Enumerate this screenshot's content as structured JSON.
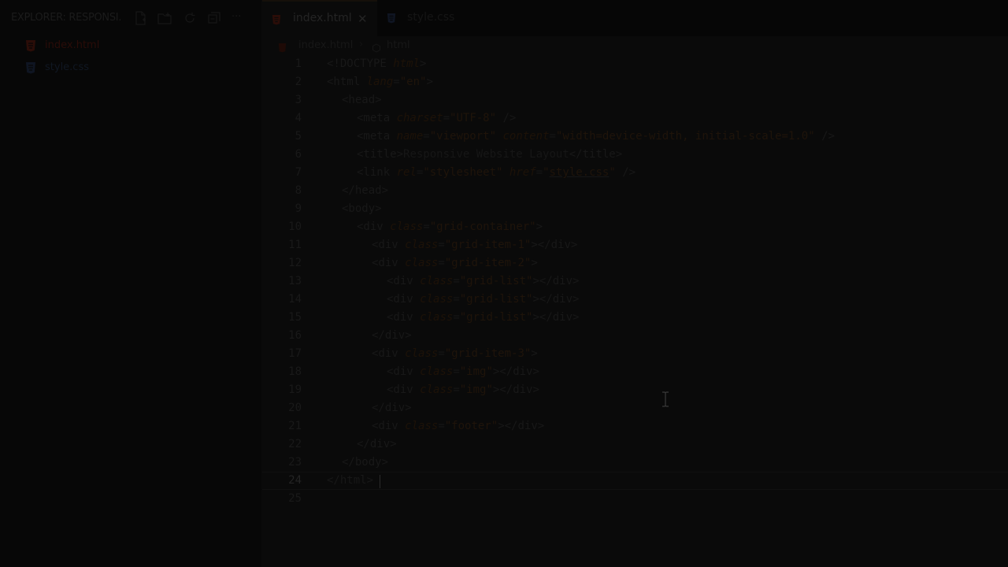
{
  "sidebar": {
    "title": "EXPLORER: RESPONSI...",
    "icons": [
      "new-file-icon",
      "new-folder-icon",
      "refresh-icon",
      "collapse-all-icon",
      "more-icon"
    ],
    "more_label": "···",
    "files": [
      {
        "name": "index.html",
        "icon": "html-file-icon"
      },
      {
        "name": "style.css",
        "icon": "css-file-icon"
      }
    ]
  },
  "tabs": [
    {
      "label": "index.html",
      "active": true,
      "close": "✕"
    },
    {
      "label": "style.css",
      "active": false
    }
  ],
  "breadcrumb": {
    "file": "index.html",
    "separator": "›",
    "element": "html"
  },
  "code_lines": [
    {
      "n": "1"
    },
    {
      "n": "2"
    },
    {
      "n": "3"
    },
    {
      "n": "4"
    },
    {
      "n": "5"
    },
    {
      "n": "6"
    },
    {
      "n": "7"
    },
    {
      "n": "8"
    },
    {
      "n": "9"
    },
    {
      "n": "10"
    },
    {
      "n": "11"
    },
    {
      "n": "12"
    },
    {
      "n": "13"
    },
    {
      "n": "14"
    },
    {
      "n": "15"
    },
    {
      "n": "16"
    },
    {
      "n": "17"
    },
    {
      "n": "18"
    },
    {
      "n": "19"
    },
    {
      "n": "20"
    },
    {
      "n": "21"
    },
    {
      "n": "22"
    },
    {
      "n": "23"
    },
    {
      "n": "24"
    },
    {
      "n": "25"
    }
  ],
  "code": {
    "l1": {
      "a": "<!DOCTYPE ",
      "b": "html",
      "c": ">"
    },
    "l2": {
      "a": "<html ",
      "b": "lang",
      "c": "=",
      "d": "\"en\"",
      "e": ">"
    },
    "l3": {
      "a": "<head>"
    },
    "l4": {
      "a": "<meta ",
      "b": "charset",
      "c": "=",
      "d": "\"UTF-8\"",
      "e": " />"
    },
    "l5": {
      "a": "<meta ",
      "b": "name",
      "c": "=",
      "d": "\"viewport\"",
      "e": " ",
      "f": "content",
      "g": "=",
      "h": "\"width=device-width, initial-scale=1.0\"",
      "i": " />"
    },
    "l6": {
      "a": "<title>",
      "b": "Responsive Website Layout",
      "c": "</title>"
    },
    "l7": {
      "a": "<link ",
      "b": "rel",
      "c": "=",
      "d": "\"stylesheet\"",
      "e": " ",
      "f": "href",
      "g": "=",
      "h": "\"",
      "i": "style.css",
      "j": "\"",
      "k": " />"
    },
    "l8": {
      "a": "</head>"
    },
    "l9": {
      "a": "<body>"
    },
    "l10": {
      "a": "<div ",
      "b": "class",
      "c": "=",
      "d": "\"grid-container\"",
      "e": ">"
    },
    "l11": {
      "a": "<div ",
      "b": "class",
      "c": "=",
      "d": "\"grid-item-1\"",
      "e": "></div>"
    },
    "l12": {
      "a": "<div ",
      "b": "class",
      "c": "=",
      "d": "\"grid-item-2\"",
      "e": ">"
    },
    "l13": {
      "a": "<div ",
      "b": "class",
      "c": "=",
      "d": "\"grid-list\"",
      "e": "></div>"
    },
    "l14": {
      "a": "<div ",
      "b": "class",
      "c": "=",
      "d": "\"grid-list\"",
      "e": "></div>"
    },
    "l15": {
      "a": "<div ",
      "b": "class",
      "c": "=",
      "d": "\"grid-list\"",
      "e": "></div>"
    },
    "l16": {
      "a": "</div>"
    },
    "l17": {
      "a": "<div ",
      "b": "class",
      "c": "=",
      "d": "\"grid-item-3\"",
      "e": ">"
    },
    "l18": {
      "a": "<div ",
      "b": "class",
      "c": "=",
      "d": "\"img\"",
      "e": "></div>"
    },
    "l19": {
      "a": "<div ",
      "b": "class",
      "c": "=",
      "d": "\"img\"",
      "e": "></div>"
    },
    "l20": {
      "a": "</div>"
    },
    "l21": {
      "a": "<div ",
      "b": "class",
      "c": "=",
      "d": "\"footer\"",
      "e": "></div>"
    },
    "l22": {
      "a": "</div>"
    },
    "l23": {
      "a": "</body>"
    },
    "l24": {
      "a": "</html>"
    }
  },
  "colors": {
    "html_icon": "#2b0d08",
    "css_icon": "#0f1522",
    "tag": "#181818",
    "attribute": "#1d1208",
    "string": "#1f140a"
  }
}
